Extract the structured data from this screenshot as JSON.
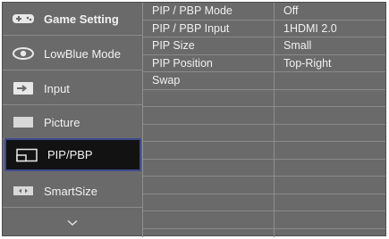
{
  "menu": {
    "items": [
      {
        "label": "Game Setting",
        "icon": "gamepad-icon"
      },
      {
        "label": "LowBlue Mode",
        "icon": "eye-icon"
      },
      {
        "label": "Input",
        "icon": "input-arrow-icon"
      },
      {
        "label": "Picture",
        "icon": "picture-icon"
      },
      {
        "label": "PIP/PBP",
        "icon": "pip-icon"
      },
      {
        "label": "SmartSize",
        "icon": "smartsize-icon"
      }
    ],
    "more": "⌄"
  },
  "submenu": {
    "items": [
      "PIP / PBP Mode",
      "PIP / PBP Input",
      "PIP Size",
      "PIP Position",
      "Swap"
    ]
  },
  "values": {
    "items": [
      "Off",
      "1HDMI 2.0",
      "Small",
      "Top-Right"
    ]
  },
  "colors": {
    "panel": "#6a6a6a",
    "active_bg": "#121212",
    "active_border": "#3f4b8f"
  }
}
